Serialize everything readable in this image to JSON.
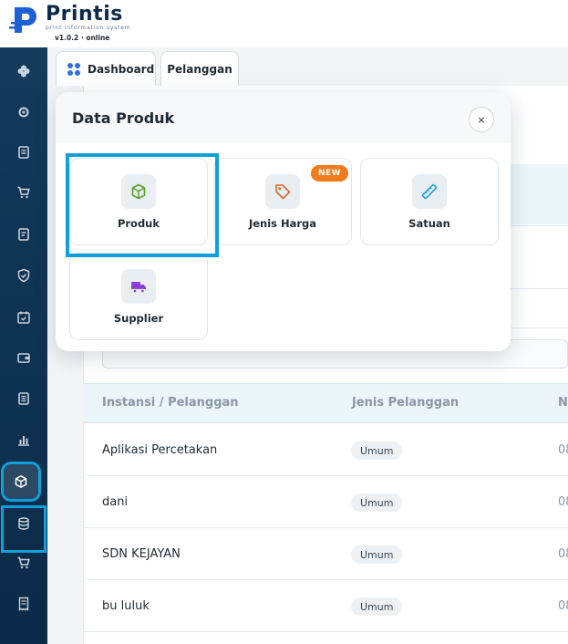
{
  "brand": {
    "name": "Printis",
    "tagline": "print information system",
    "version": "v1.0.2 · online"
  },
  "colors": {
    "sidebar": "#0b2a47",
    "accent_highlight": "#0fa0dc",
    "new_badge": "#f07a1c",
    "tab_dots": "#2f6fe0"
  },
  "sidebar": {
    "items": [
      {
        "icon": "flower-icon"
      },
      {
        "icon": "gear-icon"
      },
      {
        "icon": "document-icon"
      },
      {
        "icon": "cart-icon"
      },
      {
        "icon": "list-icon"
      },
      {
        "icon": "shield-check-icon"
      },
      {
        "icon": "calendar-check-icon"
      },
      {
        "icon": "wallet-icon"
      },
      {
        "icon": "report-icon"
      },
      {
        "icon": "bar-chart-icon"
      },
      {
        "icon": "box-icon",
        "active": true
      },
      {
        "icon": "database-icon"
      },
      {
        "icon": "cart-icon"
      },
      {
        "icon": "receipt-icon"
      }
    ]
  },
  "tabs": [
    {
      "label": "Dashboard",
      "icon": "grid-dots-icon"
    },
    {
      "label": "Pelanggan"
    }
  ],
  "table": {
    "headers": [
      "Instansi / Pelanggan",
      "Jenis Pelanggan",
      "N"
    ],
    "rows": [
      {
        "name": "Aplikasi Percetakan",
        "type": "Umum",
        "num": "08"
      },
      {
        "name": "dani",
        "type": "Umum",
        "num": "08"
      },
      {
        "name": "SDN KEJAYAN",
        "type": "Umum",
        "num": "08"
      },
      {
        "name": "bu luluk",
        "type": "Umum",
        "num": "08"
      }
    ]
  },
  "popup": {
    "title": "Data Produk",
    "close_label": "×",
    "tiles": [
      {
        "label": "Produk",
        "icon": "cube-icon",
        "color": "#5aa02c"
      },
      {
        "label": "Jenis Harga",
        "icon": "price-tag-icon",
        "color": "#e0662a",
        "badge": "NEW"
      },
      {
        "label": "Satuan",
        "icon": "ruler-icon",
        "color": "#1aa0d8"
      },
      {
        "label": "Supplier",
        "icon": "truck-icon",
        "color": "#8a3fd6"
      }
    ]
  }
}
